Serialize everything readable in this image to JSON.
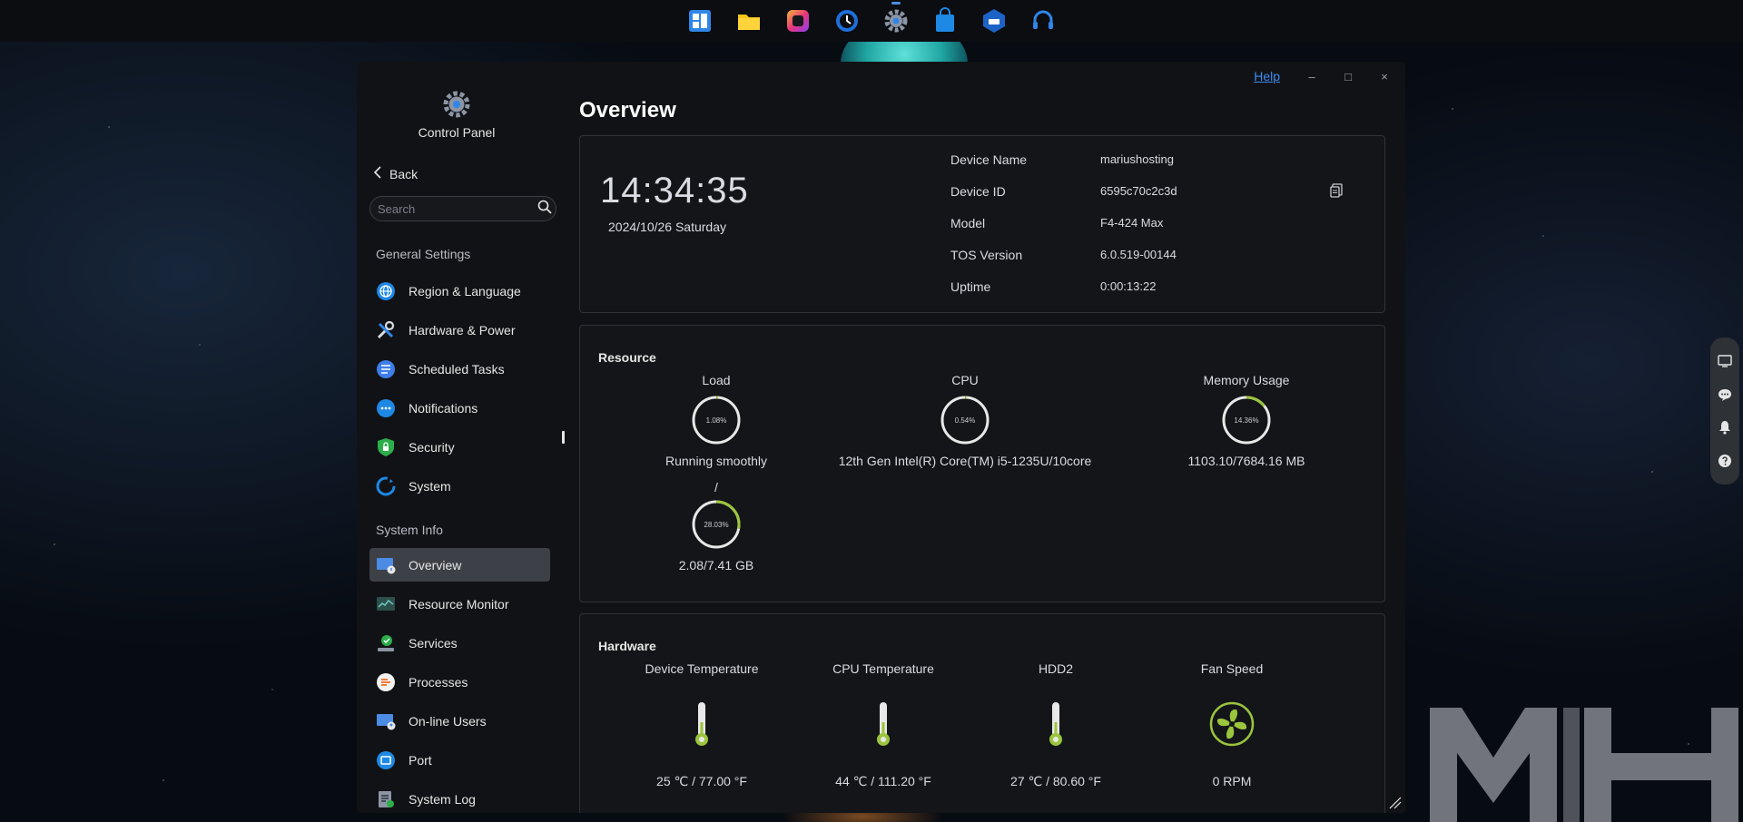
{
  "taskbar": {
    "icons": [
      "app-grid-icon",
      "folder-icon",
      "media-icon",
      "backup-clock-icon",
      "control-panel-gear-icon",
      "app-store-bag-icon",
      "docker-icon",
      "support-headset-icon"
    ]
  },
  "window": {
    "help_label": "Help",
    "minimize_glyph": "–",
    "maximize_glyph": "□",
    "close_glyph": "×"
  },
  "sidebar": {
    "app_title": "Control Panel",
    "back_label": "Back",
    "search_placeholder": "Search",
    "general_title": "General Settings",
    "general_items": [
      {
        "label": "Region & Language",
        "icon": "globe-icon"
      },
      {
        "label": "Hardware & Power",
        "icon": "tools-icon"
      },
      {
        "label": "Scheduled Tasks",
        "icon": "task-list-icon"
      },
      {
        "label": "Notifications",
        "icon": "chat-bubble-icon"
      },
      {
        "label": "Security",
        "icon": "shield-icon"
      },
      {
        "label": "System",
        "icon": "system-refresh-icon"
      }
    ],
    "info_title": "System Info",
    "info_items": [
      {
        "label": "Overview",
        "icon": "overview-monitor-icon",
        "active": true
      },
      {
        "label": "Resource Monitor",
        "icon": "resource-monitor-icon"
      },
      {
        "label": "Services",
        "icon": "services-check-icon"
      },
      {
        "label": "Processes",
        "icon": "processes-icon"
      },
      {
        "label": "On-line Users",
        "icon": "online-users-icon"
      },
      {
        "label": "Port",
        "icon": "port-icon"
      },
      {
        "label": "System Log",
        "icon": "system-log-icon"
      }
    ]
  },
  "overview": {
    "title": "Overview",
    "time": "14:34:35",
    "date": "2024/10/26 Saturday",
    "device_info": [
      {
        "label": "Device Name",
        "value": "mariushosting"
      },
      {
        "label": "Device ID",
        "value": "6595c70c2c3d"
      },
      {
        "label": "Model",
        "value": "F4-424 Max"
      },
      {
        "label": "TOS Version",
        "value": "6.0.519-00144"
      },
      {
        "label": "Uptime",
        "value": "0:00:13:22"
      }
    ]
  },
  "resource": {
    "heading": "Resource",
    "load": {
      "label": "Load",
      "percent": 1.08,
      "percent_text": "1.08%",
      "status": "Running smoothly",
      "separator": "/",
      "mem_percent": 28.03,
      "mem_percent_text": "28.03%",
      "mem_value": "2.08/7.41 GB"
    },
    "cpu": {
      "label": "CPU",
      "percent": 0.54,
      "percent_text": "0.54%",
      "detail": "12th Gen Intel(R) Core(TM) i5-1235U/10core"
    },
    "memory": {
      "label": "Memory Usage",
      "percent": 14.36,
      "percent_text": "14.36%",
      "detail": "1103.10/7684.16 MB"
    },
    "accent_color": "#9bc53d"
  },
  "hardware": {
    "heading": "Hardware",
    "items": [
      {
        "label": "Device Temperature",
        "value": "25 ℃ / 77.00 °F",
        "icon": "thermometer-icon"
      },
      {
        "label": "CPU Temperature",
        "value": "44 ℃ / 111.20 °F",
        "icon": "thermometer-icon"
      },
      {
        "label": "HDD2",
        "value": "27 ℃ / 80.60 °F",
        "icon": "thermometer-icon"
      },
      {
        "label": "Fan Speed",
        "value": "0 RPM",
        "icon": "fan-icon"
      }
    ]
  },
  "side_dock": {
    "icons": [
      "desktop-widget-icon",
      "message-icon",
      "bell-icon",
      "help-icon"
    ]
  },
  "colors": {
    "accent_blue": "#3d8df5",
    "active_nav": "#3d4046",
    "gauge_green": "#9bc53d"
  }
}
